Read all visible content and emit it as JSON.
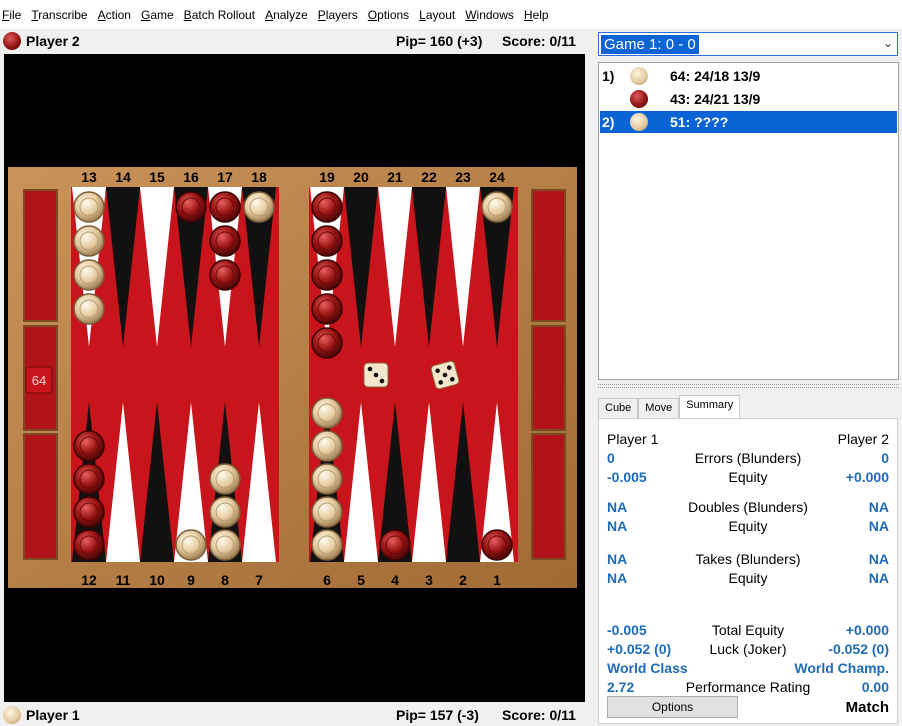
{
  "menu": [
    "File",
    "Transcribe",
    "Action",
    "Game",
    "Batch Rollout",
    "Analyze",
    "Players",
    "Options",
    "Layout",
    "Windows",
    "Help"
  ],
  "top_player": {
    "name": "Player 2",
    "pip": "Pip= 160 (+3)",
    "score": "Score: 0/11",
    "color": "red"
  },
  "bottom_player": {
    "name": "Player 1",
    "pip": "Pip= 157 (-3)",
    "score": "Score: 0/11",
    "color": "tan"
  },
  "board": {
    "top_point_labels": [
      "13",
      "14",
      "15",
      "16",
      "17",
      "18",
      "19",
      "20",
      "21",
      "22",
      "23",
      "24"
    ],
    "bottom_point_labels": [
      "12",
      "11",
      "10",
      "9",
      "8",
      "7",
      "6",
      "5",
      "4",
      "3",
      "2",
      "1"
    ],
    "cube_value": "64",
    "dice": [
      3,
      5
    ],
    "points": {
      "13": {
        "color": "tan",
        "count": 4
      },
      "16": {
        "color": "red",
        "count": 1
      },
      "17": {
        "color": "red",
        "count": 3
      },
      "18": {
        "color": "tan",
        "count": 1
      },
      "19": {
        "color": "red",
        "count": 5
      },
      "24": {
        "color": "tan",
        "count": 1
      },
      "12": {
        "color": "red",
        "count": 4
      },
      "9": {
        "color": "tan",
        "count": 1
      },
      "8": {
        "color": "tan",
        "count": 3
      },
      "6": {
        "color": "tan",
        "count": 5
      },
      "4": {
        "color": "red",
        "count": 1
      },
      "1": {
        "color": "red",
        "count": 1
      }
    },
    "colors": {
      "frame": "#b8824a",
      "felt": "#c8141a",
      "black_point": "#111111",
      "white_point": "#ffffff"
    }
  },
  "game_selector": {
    "value": "Game 1: 0 - 0"
  },
  "moves": [
    {
      "num": "1)",
      "chip": "tan",
      "text": "64: 24/18 13/9",
      "selected": false
    },
    {
      "num": "",
      "chip": "red",
      "text": "43: 24/21 13/9",
      "selected": false
    },
    {
      "num": "2)",
      "chip": "tan",
      "text": "51: ????",
      "selected": true
    }
  ],
  "tabs": [
    "Cube",
    "Move",
    "Summary"
  ],
  "active_tab": "Summary",
  "summary": {
    "player1": "Player 1",
    "player2": "Player 2",
    "rows": [
      {
        "left": "0",
        "label": "Errors (Blunders)",
        "right": "0"
      },
      {
        "left": "-0.005",
        "label": "Equity",
        "right": "+0.000"
      },
      {
        "left": "NA",
        "label": "Doubles (Blunders)",
        "right": "NA"
      },
      {
        "left": "NA",
        "label": "Equity",
        "right": "NA"
      },
      {
        "left": "NA",
        "label": "Takes (Blunders)",
        "right": "NA"
      },
      {
        "left": "NA",
        "label": "Equity",
        "right": "NA"
      },
      {
        "left": "-0.005",
        "label": "Total Equity",
        "right": "+0.000"
      },
      {
        "left": "+0.052 (0)",
        "label": "Luck (Joker)",
        "right": "-0.052 (0)"
      },
      {
        "left": "World Class",
        "label": "",
        "right": "World Champ."
      },
      {
        "left": "2.72",
        "label": "Performance Rating",
        "right": "0.00"
      }
    ],
    "options_button": "Options",
    "match_label": "Match"
  }
}
